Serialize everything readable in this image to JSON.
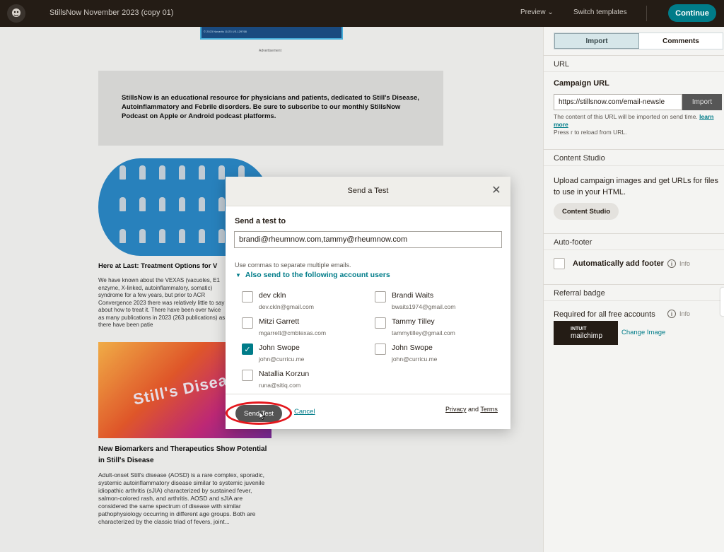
{
  "header": {
    "title": "StillsNow November 2023 (copy 01)",
    "preview_label": "Preview",
    "switch_templates_label": "Switch templates",
    "continue_label": "Continue"
  },
  "canvas": {
    "top_image_text": "© 2023 Novartis          11/23          US-129768",
    "advertisement_label": "Advertisement",
    "intro_text": "StillsNow is an educational resource for physicians and patients, dedicated to Still's Disease, Autoinflammatory and Febrile disorders. Be sure to subscribe to our monthly StillsNow Podcast on Apple or Android podcast platforms.",
    "article1_title": "Here at Last: Treatment Options for V",
    "article1_body": "We have known about the VEXAS (vacuoles, E1 enzyme, X-linked, autoinflammatory, somatic) syndrome for a few years, but prior to ACR Convergence 2023 there was relatively little to say about how to treat it. There have been over twice as many publications in 2023 (263 publications) as there have been patie",
    "article2_image_text": "Still's Disease",
    "article2_title": "New Biomarkers and Therapeutics Show Potential in Still's Disease",
    "article2_body": "Adult-onset Still's disease (AOSD) is a rare complex, sporadic, systemic autoinflammatory disease similar to systemic juvenile idiopathic arthritis (sJIA) characterized by sustained fever, salmon-colored rash, and arthritis. AOSD and sJIA are considered the same spectrum of disease with similar pathophysiology occurring in different age groups. Both are characterized by the classic triad of fevers, joint..."
  },
  "panel": {
    "tabs": [
      {
        "label": "Import"
      },
      {
        "label": "Comments"
      }
    ],
    "url_section": "URL",
    "campaign_url_label": "Campaign URL",
    "campaign_url_value": "https://stillsnow.com/email-newsle",
    "import_button": "Import",
    "url_note_1": "The content of this URL will be imported on send time.",
    "learn_more": "learn more",
    "url_note_2": "Press r to reload from URL.",
    "content_studio_section": "Content Studio",
    "content_studio_desc": "Upload campaign images and get URLs for files to use in your HTML.",
    "content_studio_button": "Content Studio",
    "auto_footer_section": "Auto-footer",
    "auto_footer_label": "Automatically add footer",
    "info_label": "Info",
    "referral_section": "Referral badge",
    "referral_required": "Required for all free accounts",
    "badge_top": "INTUIT",
    "badge_bottom": "mailchimp",
    "change_image": "Change Image"
  },
  "modal": {
    "title": "Send a Test",
    "send_to_label": "Send a test to",
    "emails_value": "brandi@rheumnow.com,tammy@rheumnow.com",
    "hint": "Use commas to separate multiple emails.",
    "also_send_label": "Also send to the following account users",
    "users": [
      {
        "name": "dev ckln",
        "email": "dev.ckln@gmail.com",
        "checked": false
      },
      {
        "name": "Brandi Waits",
        "email": "bwaits1974@gmail.com",
        "checked": false
      },
      {
        "name": "Mitzi Garrett",
        "email": "mgarrett@cmbtexas.com",
        "checked": false
      },
      {
        "name": "Tammy Tilley",
        "email": "tammytilley@gmail.com",
        "checked": false
      },
      {
        "name": "John Swope",
        "email": "john@curricu.me",
        "checked": true
      },
      {
        "name": "John Swope",
        "email": "john@curricu.me",
        "checked": false
      },
      {
        "name": "Natallia Korzun",
        "email": "runa@sitiq.com",
        "checked": false
      }
    ],
    "send_button": "Send Test",
    "cancel_label": "Cancel",
    "privacy_label": "Privacy",
    "and_label": "and",
    "terms_label": "Terms"
  },
  "colors": {
    "accent": "#007c89",
    "topbar": "#241c15",
    "highlight_ring": "#e3171d"
  }
}
